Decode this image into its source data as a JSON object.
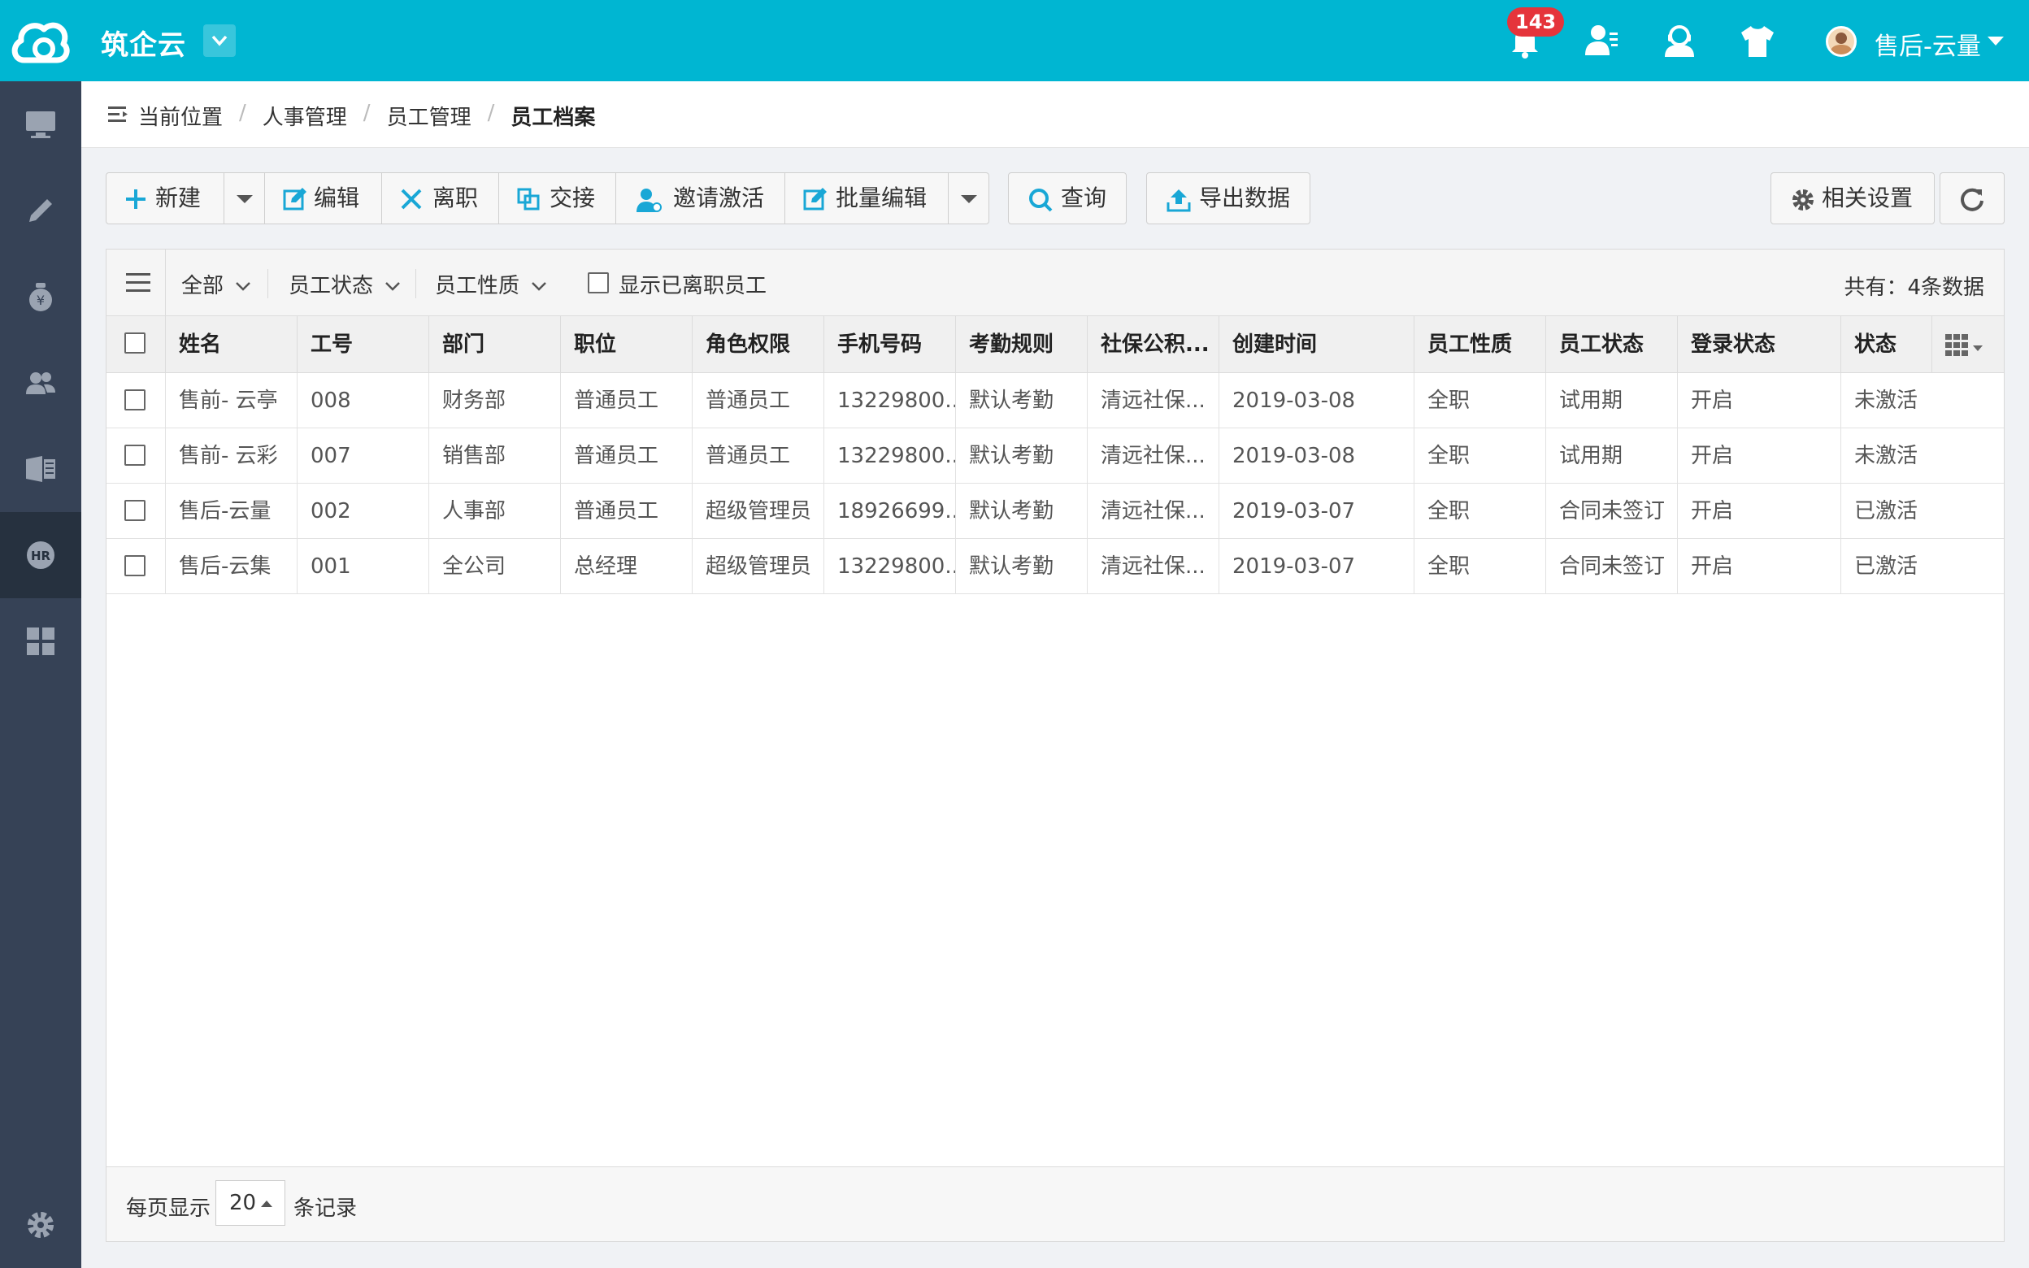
{
  "header": {
    "app_title": "筑企云",
    "notification_count": "143",
    "user_name": "售后-云量"
  },
  "breadcrumb": {
    "location_label": "当前位置",
    "items": [
      "人事管理",
      "员工管理",
      "员工档案"
    ]
  },
  "toolbar": {
    "new_label": "新建",
    "edit_label": "编辑",
    "resign_label": "离职",
    "handover_label": "交接",
    "invite_label": "邀请激活",
    "batch_edit_label": "批量编辑",
    "query_label": "查询",
    "export_label": "导出数据",
    "settings_label": "相关设置"
  },
  "filters": {
    "all_label": "全部",
    "status_label": "员工状态",
    "type_label": "员工性质",
    "show_resigned_label": "显示已离职员工",
    "total_text": "共有：4条数据"
  },
  "table": {
    "columns": [
      "姓名",
      "工号",
      "部门",
      "职位",
      "角色权限",
      "手机号码",
      "考勤规则",
      "社保公积...",
      "创建时间",
      "员工性质",
      "员工状态",
      "登录状态",
      "状态"
    ],
    "rows": [
      {
        "name": "售前- 云亭",
        "id": "008",
        "dept": "财务部",
        "position": "普通员工",
        "role": "普通员工",
        "phone": "13229800...",
        "attendance": "默认考勤",
        "social": "清远社保...",
        "created": "2019-03-08",
        "type": "全职",
        "emp_status": "试用期",
        "login": "开启",
        "status": "未激活"
      },
      {
        "name": "售前- 云彩",
        "id": "007",
        "dept": "销售部",
        "position": "普通员工",
        "role": "普通员工",
        "phone": "13229800...",
        "attendance": "默认考勤",
        "social": "清远社保...",
        "created": "2019-03-08",
        "type": "全职",
        "emp_status": "试用期",
        "login": "开启",
        "status": "未激活"
      },
      {
        "name": "售后-云量",
        "id": "002",
        "dept": "人事部",
        "position": "普通员工",
        "role": "超级管理员",
        "phone": "18926699...",
        "attendance": "默认考勤",
        "social": "清远社保...",
        "created": "2019-03-07",
        "type": "全职",
        "emp_status": "合同未签订",
        "login": "开启",
        "status": "已激活"
      },
      {
        "name": "售后-云集",
        "id": "001",
        "dept": "全公司",
        "position": "总经理",
        "role": "超级管理员",
        "phone": "13229800...",
        "attendance": "默认考勤",
        "social": "清远社保...",
        "created": "2019-03-07",
        "type": "全职",
        "emp_status": "合同未签订",
        "login": "开启",
        "status": "已激活"
      }
    ]
  },
  "footer": {
    "per_page_label": "每页显示",
    "page_size": "20",
    "records_label": "条记录"
  },
  "colors": {
    "topbar": "#00b6d2",
    "sidebar": "#364256",
    "link": "#1a9bd4",
    "trial": "#19a7d6",
    "unsigned": "#f0a33c",
    "active": "#2aa84a",
    "inactive": "#aaaaaa",
    "badge": "#e5343b"
  },
  "icons": {
    "sidebar": [
      "monitor-icon",
      "pencil-icon",
      "moneybag-icon",
      "users-icon",
      "office-icon",
      "hr-icon",
      "grid-icon",
      "settings-gear-icon"
    ],
    "topbar": [
      "bell-icon",
      "contact-icon",
      "support-icon",
      "shirt-icon"
    ]
  }
}
